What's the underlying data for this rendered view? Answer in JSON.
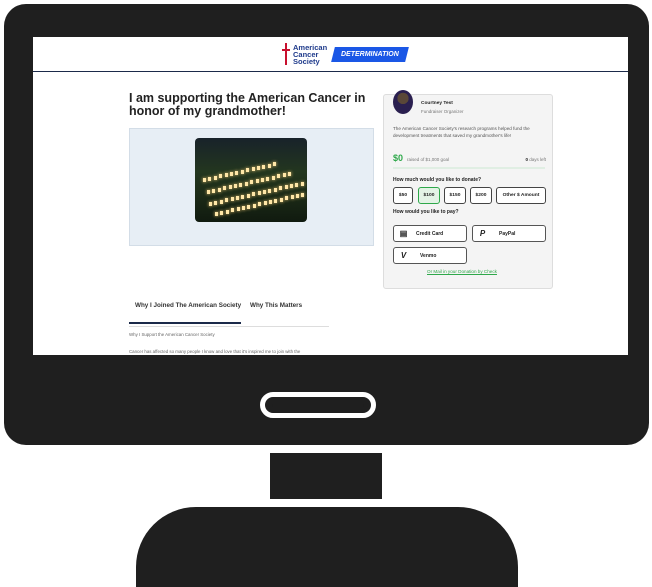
{
  "brand": {
    "logo_line1": "American",
    "logo_line2": "Cancer",
    "logo_line3": "Society",
    "campaign_badge": "DETERMINATION",
    "accent_color": "#1a57e6",
    "success_color": "#2ea84a"
  },
  "page": {
    "title": "I am supporting the American Cancer in honor of my grandmother!"
  },
  "tabs": [
    {
      "label": "Why I Joined The American Society",
      "active": true
    },
    {
      "label": "Why This Matters",
      "active": false
    }
  ],
  "content": {
    "heading_line": "Why I Support the American Cancer Society",
    "paragraph_start": "Cancer has affected so many people I know and love that it's inspired me to join with the"
  },
  "organizer": {
    "name": "Courtney Test",
    "role": "Fundraiser Organizer"
  },
  "campaign": {
    "description": "The American Cancer Society's research programs helped fund the development treatments that saved my grandmother's life!",
    "raised": "$0",
    "goal_text": "raised of $1,000 goal",
    "days_number": "0",
    "days_text": "days left",
    "progress_fraction": 0.0
  },
  "donation": {
    "question": "How much would you like to donate?",
    "amounts": [
      "$50",
      "$100",
      "$150",
      "$200",
      "Other $ Amount"
    ],
    "selected": "$100",
    "pay_question": "How would you like to pay?",
    "methods": [
      {
        "label": "Credit Card",
        "icon": "credit-card-icon"
      },
      {
        "label": "PayPal",
        "icon": "paypal-icon"
      },
      {
        "label": "Venmo",
        "icon": "venmo-icon"
      }
    ],
    "mail_link": "Or Mail in your Donation by Check"
  }
}
